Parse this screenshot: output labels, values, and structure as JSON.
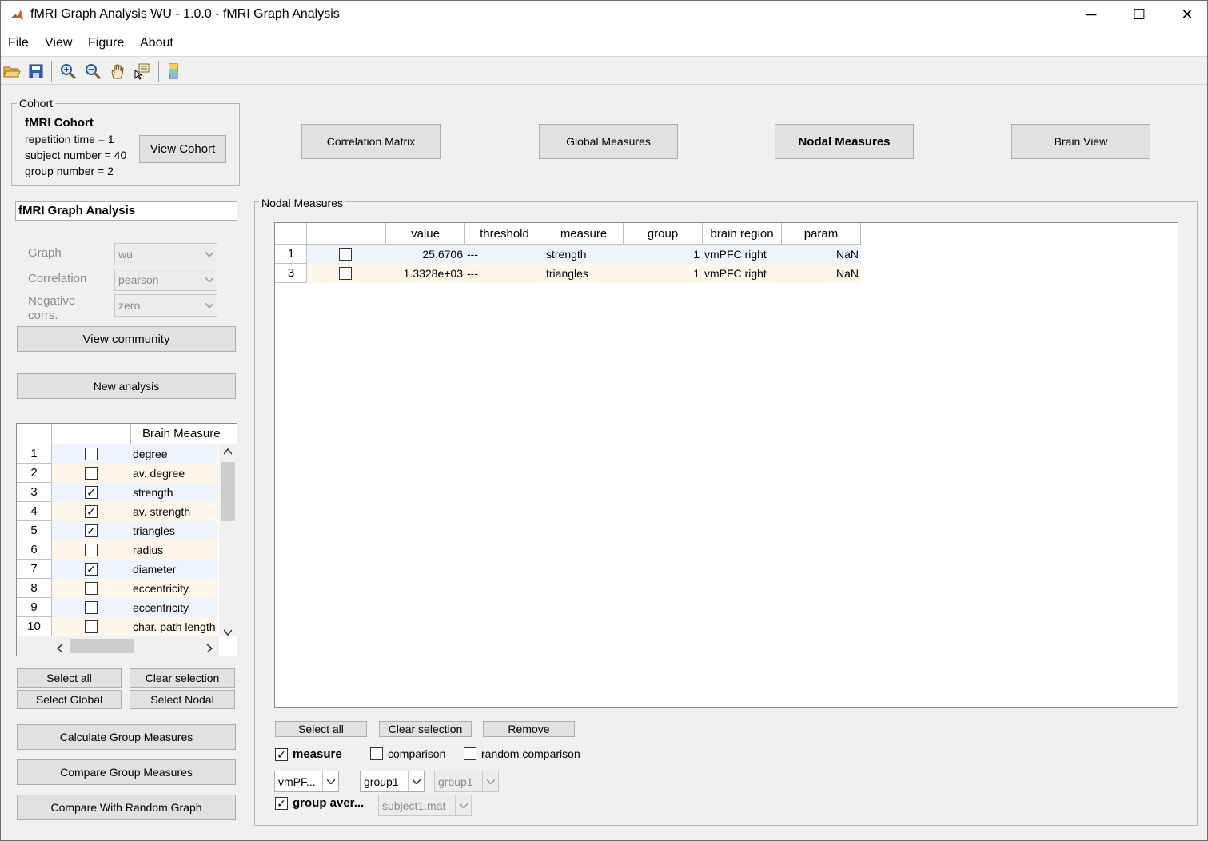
{
  "window": {
    "title": "fMRI Graph Analysis WU - 1.0.0 - fMRI Graph Analysis",
    "minimize_glyph": "─",
    "maximize_glyph": "☐",
    "close_glyph": "✕"
  },
  "menu": {
    "items": [
      "File",
      "View",
      "Figure",
      "About"
    ]
  },
  "toolbar": {
    "icons": [
      "open-folder-icon",
      "save-icon",
      "zoom-in-icon",
      "zoom-out-icon",
      "pan-hand-icon",
      "data-cursor-icon",
      "colorbar-icon"
    ]
  },
  "cohort": {
    "group_title": "Cohort",
    "name": "fMRI Cohort",
    "repetition_time": "repetition time = 1",
    "subject_number": "subject number = 40",
    "group_number": "group number = 2",
    "view_button": "View Cohort"
  },
  "top_buttons": {
    "correlation_matrix": "Correlation Matrix",
    "global_measures": "Global Measures",
    "nodal_measures": "Nodal Measures",
    "brain_view": "Brain View"
  },
  "analysis": {
    "name": "fMRI Graph Analysis",
    "graph_label": "Graph",
    "graph_value": "wu",
    "correlation_label": "Correlation",
    "correlation_value": "pearson",
    "negative_label_1": "Negative",
    "negative_label_2": "corrs.",
    "negative_value": "zero",
    "view_community": "View community",
    "new_analysis": "New analysis"
  },
  "measures_table": {
    "header": "Brain Measure",
    "rows": [
      {
        "num": "1",
        "checked": "",
        "name": "degree"
      },
      {
        "num": "2",
        "checked": "",
        "name": "av. degree"
      },
      {
        "num": "3",
        "checked": "✓",
        "name": "strength"
      },
      {
        "num": "4",
        "checked": "✓",
        "name": "av. strength"
      },
      {
        "num": "5",
        "checked": "✓",
        "name": "triangles"
      },
      {
        "num": "6",
        "checked": "",
        "name": "radius"
      },
      {
        "num": "7",
        "checked": "✓",
        "name": "diameter"
      },
      {
        "num": "8",
        "checked": "",
        "name": "eccentricity"
      },
      {
        "num": "9",
        "checked": "",
        "name": "eccentricity"
      },
      {
        "num": "10",
        "checked": "",
        "name": "char. path length"
      }
    ]
  },
  "left_buttons": {
    "select_all": "Select all",
    "clear_selection": "Clear selection",
    "select_global": "Select Global",
    "select_nodal": "Select Nodal",
    "calculate": "Calculate Group Measures",
    "compare": "Compare Group Measures",
    "compare_random": "Compare With Random Graph"
  },
  "nodal": {
    "group_title": "Nodal Measures",
    "columns": [
      "value",
      "threshold",
      "measure",
      "group",
      "brain region",
      "param"
    ],
    "rows": [
      {
        "num": "1",
        "value": "25.6706",
        "threshold": "---",
        "measure": "strength",
        "group": "1",
        "region": "vmPFC right",
        "param": "NaN"
      },
      {
        "num": "3",
        "value": "1.3328e+03",
        "threshold": "---",
        "measure": "triangles",
        "group": "1",
        "region": "vmPFC right",
        "param": "NaN"
      }
    ],
    "select_all": "Select all",
    "clear_selection": "Clear selection",
    "remove": "Remove",
    "measure_label": "measure",
    "comparison_label": "comparison",
    "random_comparison_label": "random comparison",
    "region_dropdown": "vmPF...",
    "group_dropdown": "group1",
    "group2_dropdown": "group1",
    "group_average_label": "group aver...",
    "subject_dropdown": "subject1.mat"
  },
  "colors": {
    "row_odd": "#eef4fb",
    "row_even": "#fff6ea",
    "button_face": "#e1e1e1"
  }
}
